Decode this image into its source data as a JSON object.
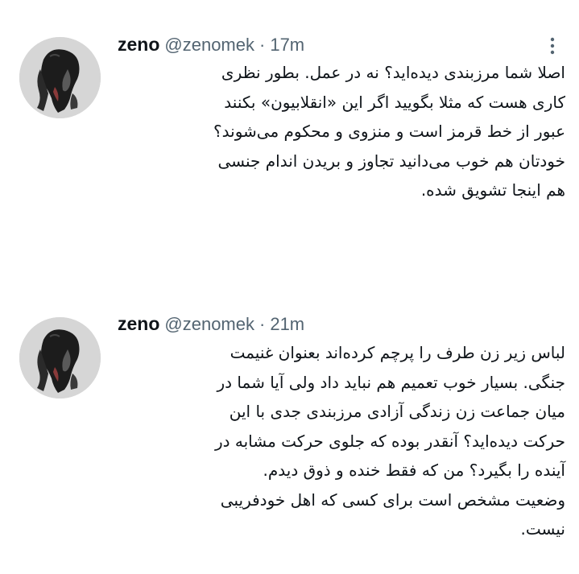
{
  "tweets": [
    {
      "user": {
        "name": "zeno",
        "handle": "@zenomek"
      },
      "separator": "·",
      "time": "17m",
      "avatar_icon": "profile-photo-dark-figure",
      "lines": [
        "اصلا شما مرزبندی دیده‌اید؟ نه در عمل. بطور نظری",
        "کاری هست که مثلا بگویید اگر این «انقلابیون» بکنند",
        "عبور از خط قرمز است و منزوی و محکوم می‌شوند؟",
        "خودتان هم خوب می‌دانید تجاوز و بریدن اندام جنسی",
        "هم اینجا تشویق شده."
      ]
    },
    {
      "user": {
        "name": "zeno",
        "handle": "@zenomek"
      },
      "separator": "·",
      "time": "21m",
      "avatar_icon": "profile-photo-dark-figure",
      "lines": [
        "لباس زیر زن طرف را پرچم کرده‌اند بعنوان غنیمت",
        "جنگی. بسیار خوب تعمیم هم نباید داد ولی آیا شما در",
        "میان جماعت زن زندگی آزادی مرزبندی جدی با این",
        "حرکت دیده‌اید؟ آنقدر بوده که جلوی حرکت مشابه در",
        "آینده را بگیرد؟ من که فقط خنده و ذوق دیدم.",
        "وضعیت مشخص است برای کسی که اهل خودفریبی",
        "نیست."
      ]
    }
  ],
  "colors": {
    "text": "#0f1419",
    "secondary": "#536471",
    "background": "#ffffff"
  },
  "icons": {
    "more": "more-options-icon"
  }
}
